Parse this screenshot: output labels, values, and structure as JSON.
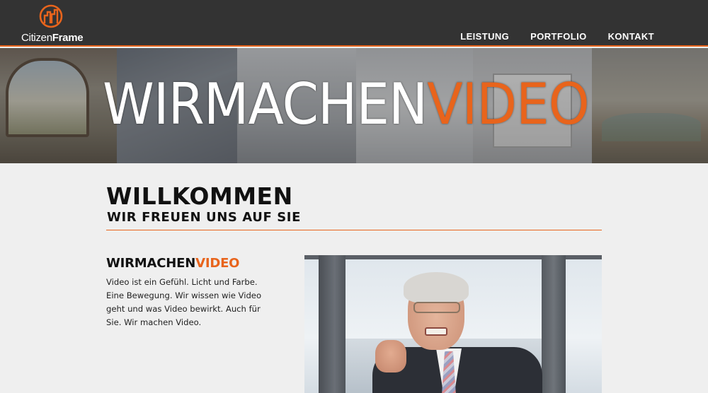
{
  "header": {
    "logo": {
      "text_light": "Citizen",
      "text_bold": "Frame",
      "icon": "city-skyline-icon"
    },
    "nav": [
      {
        "label": "LEISTUNG"
      },
      {
        "label": "PORTFOLIO"
      },
      {
        "label": "KONTAKT"
      }
    ]
  },
  "hero": {
    "title_white": "WIRMACHEN",
    "title_orange": "VIDEO"
  },
  "main": {
    "heading": "WILLKOMMEN",
    "subheading": "WIR FREUEN UNS AUF SIE",
    "intro": {
      "title_white": "WIRMACHEN",
      "title_orange": "VIDEO",
      "text": "Video ist ein Gefühl. Licht und Farbe. Eine Bewegung. Wir wissen wie Video geht und was Video bewirkt. Auch für Sie. Wir machen Video."
    }
  },
  "colors": {
    "accent": "#e8641c",
    "header_bg": "#333333",
    "page_bg": "#efefef"
  }
}
